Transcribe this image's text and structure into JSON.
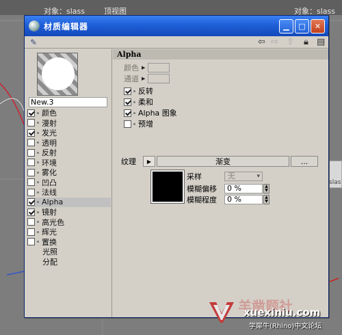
{
  "viewport": {
    "left_label": "对象：slass",
    "view_label": "顶视图",
    "right_label": "对象：slass",
    "side_label": "slas"
  },
  "dialog": {
    "title": "材质编辑器",
    "material_name": "New.3",
    "channels": [
      {
        "label": "颜色",
        "checked": true,
        "check": true
      },
      {
        "label": "漫射",
        "checked": false,
        "check": true
      },
      {
        "label": "发光",
        "checked": true,
        "check": true
      },
      {
        "label": "透明",
        "checked": false,
        "check": true
      },
      {
        "label": "反射",
        "checked": false,
        "check": true
      },
      {
        "label": "环境",
        "checked": false,
        "check": true
      },
      {
        "label": "雾化",
        "checked": false,
        "check": true
      },
      {
        "label": "凹凸",
        "checked": false,
        "check": true
      },
      {
        "label": "法线",
        "checked": false,
        "check": true
      },
      {
        "label": "Alpha",
        "checked": true,
        "check": true,
        "active": true
      },
      {
        "label": "镜射",
        "checked": true,
        "check": true
      },
      {
        "label": "高光色",
        "checked": false,
        "check": true
      },
      {
        "label": "辉光",
        "checked": false,
        "check": true
      },
      {
        "label": "置换",
        "checked": false,
        "check": true
      },
      {
        "label": "光照",
        "checked": false,
        "check": false
      },
      {
        "label": "分配",
        "checked": false,
        "check": false
      }
    ],
    "section_title": "Alpha",
    "color_label": "颜色",
    "channel_label": "通道",
    "options": [
      {
        "label": "反转",
        "checked": true
      },
      {
        "label": "柔和",
        "checked": true
      },
      {
        "label": "Alpha 图象",
        "checked": true
      },
      {
        "label": "预增",
        "checked": false
      }
    ],
    "texture_label": "纹理",
    "texture_name": "渐变",
    "texture_more": "...",
    "sample_label": "采样",
    "sample_value": "无",
    "blur_offset_label": "模糊偏移",
    "blur_offset_value": "0 %",
    "blur_amount_label": "模糊程度",
    "blur_amount_value": "0 %"
  },
  "watermark": {
    "site": "xuexiniu.com",
    "subtitle": "学犀牛(Rhino)中文论坛",
    "faint_text": "羊凿题社"
  },
  "colors": {
    "titlebar": "#1f5fd8",
    "panel": "#d4d0c8",
    "viewport": "#7d7d7d"
  }
}
